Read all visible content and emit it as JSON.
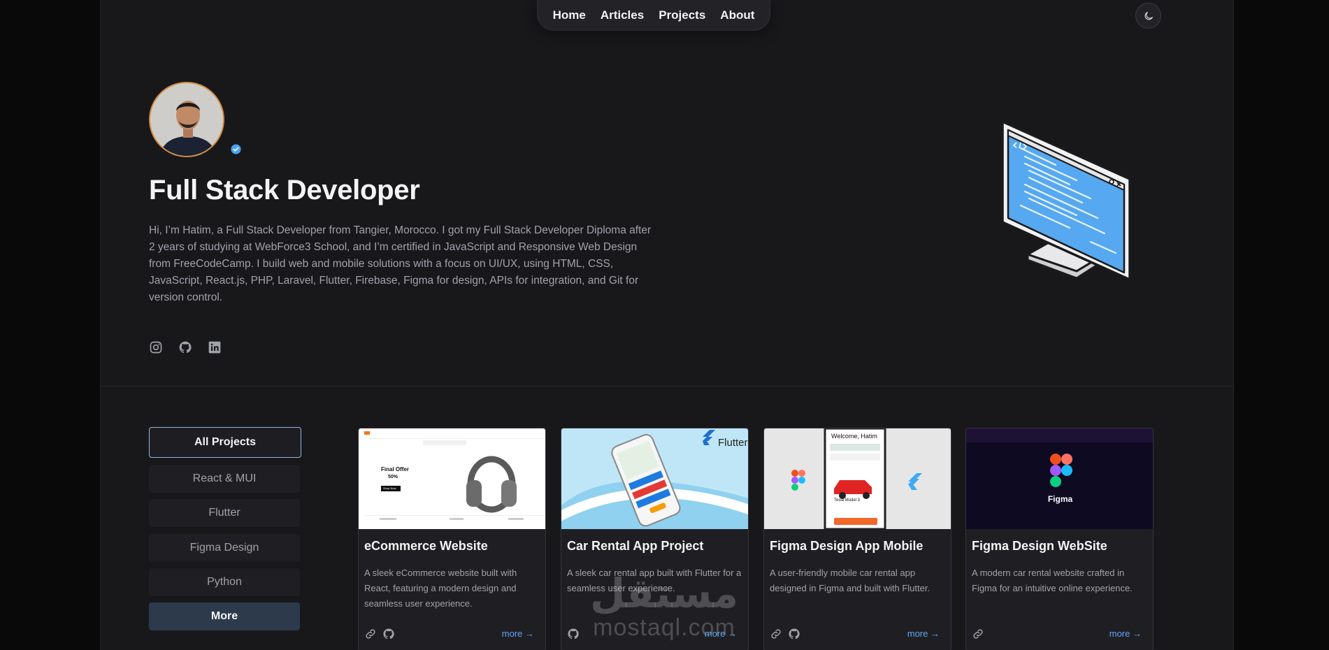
{
  "nav": {
    "items": [
      {
        "label": "Home"
      },
      {
        "label": "Articles"
      },
      {
        "label": "Projects"
      },
      {
        "label": "About"
      }
    ]
  },
  "hero": {
    "title": "Full Stack Developer",
    "bio": "Hi, I’m Hatim, a Full Stack Developer from Tangier, Morocco. I got my Full Stack Developer Diploma after 2 years of studying at WebForce3 School, and I’m certified in JavaScript and Responsive Web Design from FreeCodeCamp. I build web and mobile solutions with a focus on UI/UX, using HTML, CSS, JavaScript, React.js, PHP, Laravel, Flutter, Firebase, Figma for design, APIs for integration, and Git for version control.",
    "socials": [
      "instagram-icon",
      "github-icon",
      "linkedin-icon"
    ]
  },
  "filters": [
    {
      "label": "All Projects"
    },
    {
      "label": "React & MUI"
    },
    {
      "label": "Flutter"
    },
    {
      "label": "Figma Design"
    },
    {
      "label": "Python"
    },
    {
      "label": "More"
    }
  ],
  "cards": [
    {
      "title": "eCommerce Website",
      "desc": "A sleek eCommerce website built with React, featuring a modern design and seamless user experience.",
      "more": "more",
      "image": {
        "headline": "Final Offer",
        "discount": "50%",
        "cta": "Shop Now"
      }
    },
    {
      "title": "Car Rental App Project",
      "desc": "A sleek car rental app built with Flutter for a seamless user experience.",
      "more": "more",
      "image": {
        "brand": "Flutter"
      }
    },
    {
      "title": "Figma Design App Mobile",
      "desc": "A user-friendly mobile car rental app designed in Figma and built with Flutter.",
      "more": "more",
      "image": {
        "greeting": "Welcome, Hatim",
        "car": "Tesla Model 3"
      }
    },
    {
      "title": "Figma Design WebSite",
      "desc": "A modern car rental website crafted in Figma for an intuitive online experience.",
      "more": "more",
      "image": {
        "brand": "Figma"
      }
    }
  ],
  "watermark": {
    "arabic": "مستقل",
    "latin": "mostaql.com"
  }
}
